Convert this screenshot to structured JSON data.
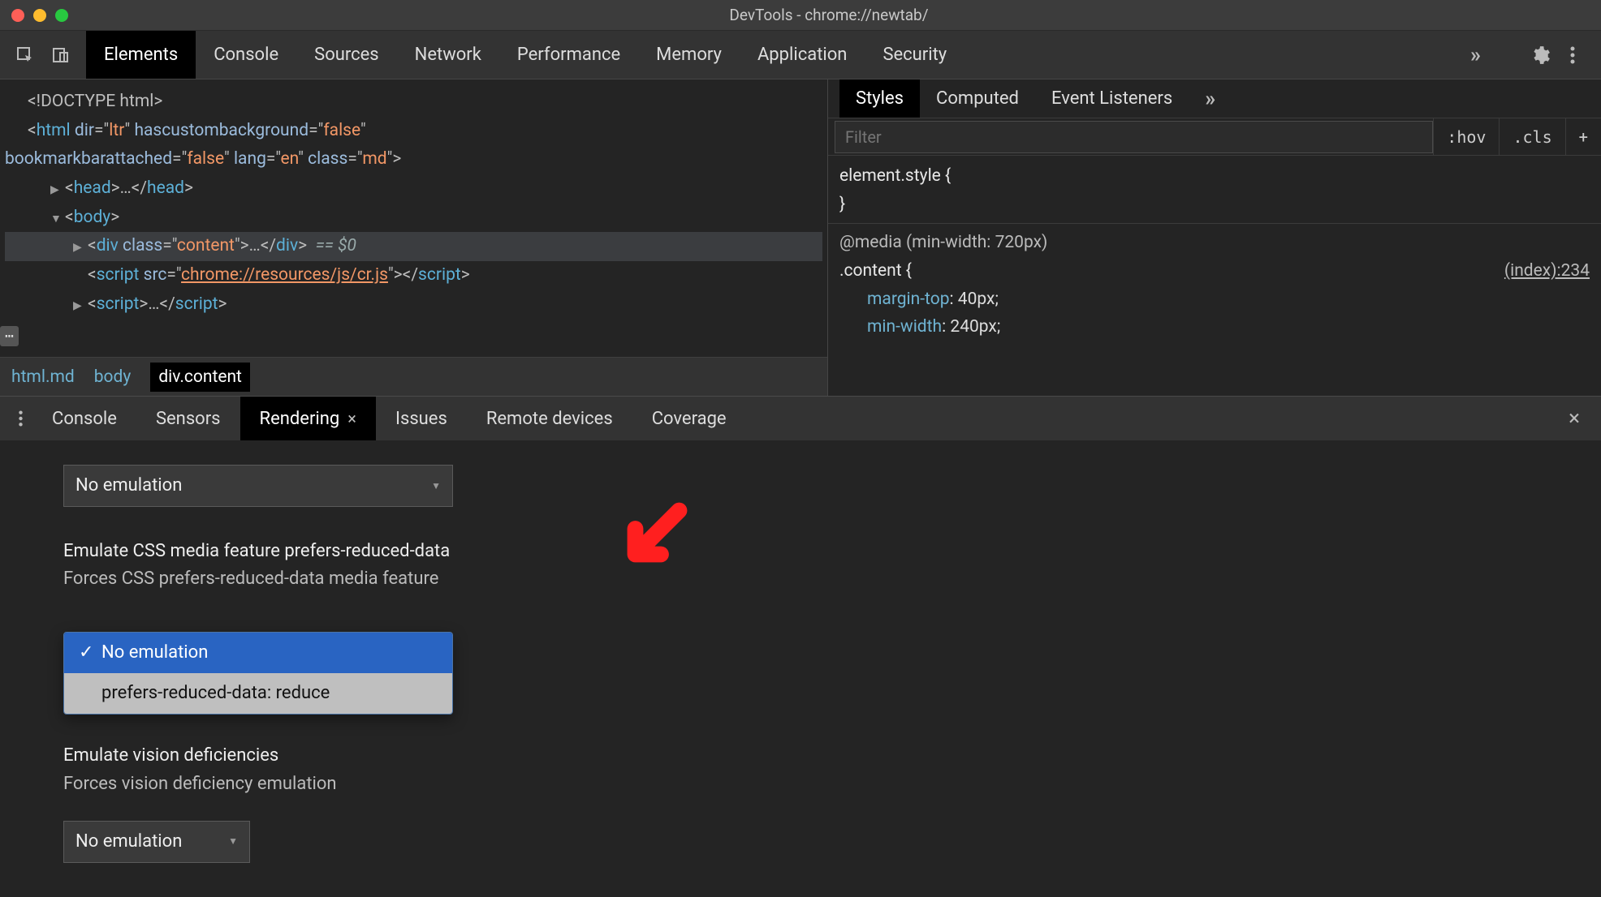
{
  "window": {
    "title": "DevTools - chrome://newtab/"
  },
  "main_tabs": {
    "items": [
      "Elements",
      "Console",
      "Sources",
      "Network",
      "Performance",
      "Memory",
      "Application",
      "Security"
    ],
    "active": "Elements",
    "overflow_glyph": "»"
  },
  "dom": {
    "doctype": "<!DOCTYPE html>",
    "html_open": {
      "tag": "html",
      "attrs": [
        {
          "n": "dir",
          "v": "ltr"
        },
        {
          "n": "hascustombackground",
          "v": "false"
        },
        {
          "n": "bookmarkbarattached",
          "v": "false"
        },
        {
          "n": "lang",
          "v": "en"
        },
        {
          "n": "class",
          "v": "md"
        }
      ]
    },
    "head_label": "<head>…</head>",
    "body_label": "<body>",
    "div_content": {
      "open": "<div class=\"content\">",
      "ellipsis": "…",
      "close": "</div>",
      "eq": "== $0"
    },
    "script1": {
      "open": "<script src=\"",
      "src": "chrome://resources/js/cr.js",
      "close": "\"></script>"
    },
    "script2": "<script>…</script>"
  },
  "breadcrumb": {
    "items": [
      "html.md",
      "body",
      "div.content"
    ],
    "active": 2
  },
  "styles_tabs": {
    "items": [
      "Styles",
      "Computed",
      "Event Listeners"
    ],
    "active": "Styles",
    "overflow_glyph": "»"
  },
  "filter": {
    "placeholder": "Filter",
    "hov": ":hov",
    "cls": ".cls",
    "plus": "+"
  },
  "styles": {
    "element_style": "element.style {",
    "brace_close": "}",
    "media": "@media (min-width: 720px)",
    "selector": ".content {",
    "source_link": "(index):234",
    "rules": [
      {
        "p": "margin-top",
        "v": "40px;"
      },
      {
        "p": "min-width",
        "v": "240px;"
      }
    ]
  },
  "drawer_tabs": {
    "items": [
      "Console",
      "Sensors",
      "Rendering",
      "Issues",
      "Remote devices",
      "Coverage"
    ],
    "active": "Rendering"
  },
  "rendering": {
    "select1": "No emulation",
    "section1_title": "Emulate CSS media feature prefers-reduced-data",
    "section1_desc": "Forces CSS prefers-reduced-data media feature",
    "dropdown": {
      "options": [
        "No emulation",
        "prefers-reduced-data: reduce"
      ],
      "selected": 0
    },
    "section2_title": "Emulate vision deficiencies",
    "section2_desc": "Forces vision deficiency emulation",
    "select3": "No emulation"
  }
}
